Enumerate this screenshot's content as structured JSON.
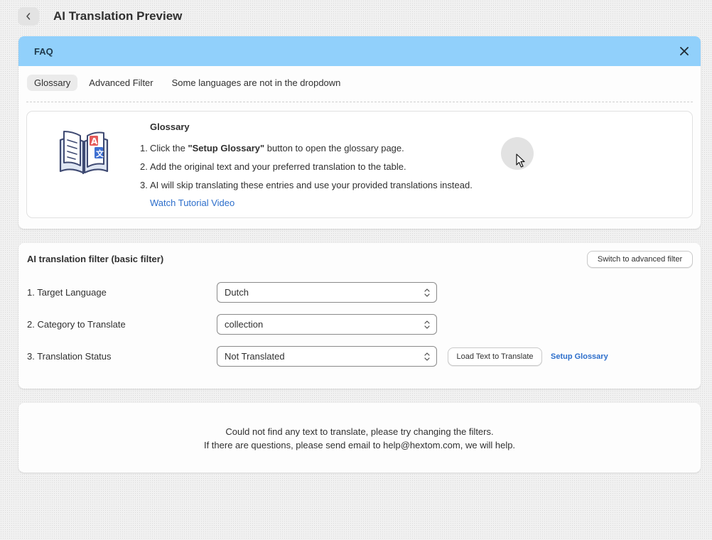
{
  "header": {
    "title": "AI Translation Preview"
  },
  "faq": {
    "title": "FAQ",
    "tabs": [
      {
        "label": "Glossary",
        "active": true
      },
      {
        "label": "Advanced Filter",
        "active": false
      },
      {
        "label": "Some languages are not in the dropdown",
        "active": false
      }
    ],
    "glossary": {
      "title": "Glossary",
      "steps": [
        {
          "num": "1.",
          "before": "Click the ",
          "bold": "\"Setup Glossary\"",
          "after": " button to open the glossary page."
        },
        {
          "num": "2.",
          "text": "Add the original text and your preferred translation to the table."
        },
        {
          "num": "3.",
          "text": "AI will skip translating these entries and use your provided translations instead."
        }
      ],
      "link": "Watch Tutorial Video"
    }
  },
  "filter": {
    "title": "AI translation filter (basic filter)",
    "switch_label": "Switch to advanced filter",
    "rows": [
      {
        "label": "1. Target Language",
        "value": "Dutch"
      },
      {
        "label": "2. Category to Translate",
        "value": "collection"
      },
      {
        "label": "3. Translation Status",
        "value": "Not Translated"
      }
    ],
    "load_label": "Load Text to Translate",
    "setup_label": "Setup Glossary"
  },
  "empty": {
    "line1": "Could not find any text to translate, please try changing the filters.",
    "line2": "If there are questions, please send email to help@hextom.com, we will help."
  },
  "colors": {
    "faq_header": "#91d0fb",
    "link": "#2c6ecb",
    "text": "#303030"
  }
}
